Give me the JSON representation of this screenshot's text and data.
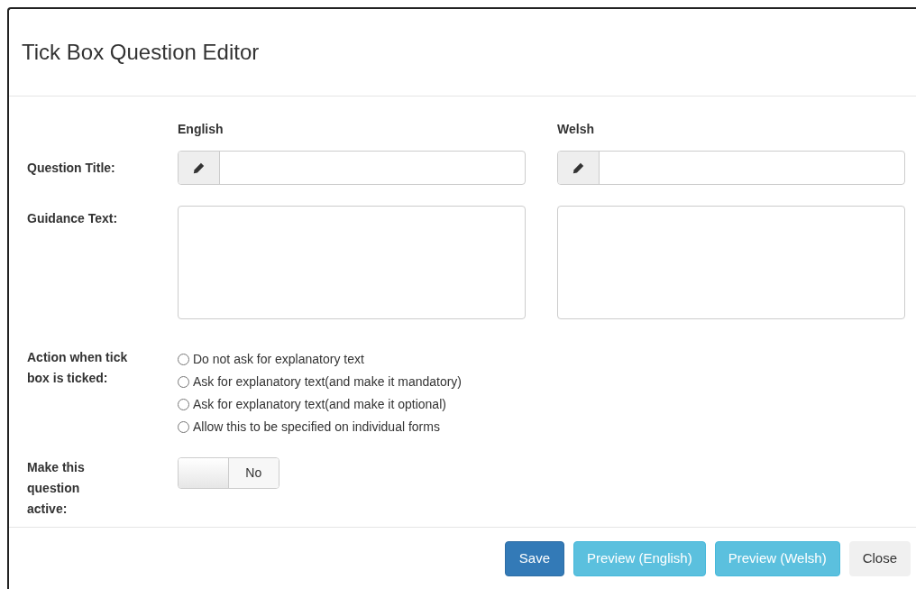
{
  "dialog": {
    "title": "Tick Box Question Editor"
  },
  "columns": [
    "English",
    "Welsh"
  ],
  "question_title": {
    "label": "Question Title:"
  },
  "guidance_text": {
    "label": "Guidance Text:"
  },
  "action": {
    "label": "Action when tick box is ticked:",
    "options": [
      {
        "label": "Do not ask for explanatory text",
        "selected": false
      },
      {
        "label": "Ask for explanatory text(and make it mandatory)",
        "selected": false
      },
      {
        "label": "Ask for explanatory text(and make it optional)",
        "selected": false
      },
      {
        "label": "Allow this to be specified on individual forms",
        "selected": false
      }
    ]
  },
  "active": {
    "label": "Make this question active:",
    "on": false,
    "state_text": "No"
  },
  "buttons": [
    {
      "label": "Save",
      "kind": "primary"
    },
    {
      "label": "Preview (English)",
      "kind": "info"
    },
    {
      "label": "Preview (Welsh)",
      "kind": "info"
    },
    {
      "label": "Close",
      "kind": "default"
    }
  ]
}
